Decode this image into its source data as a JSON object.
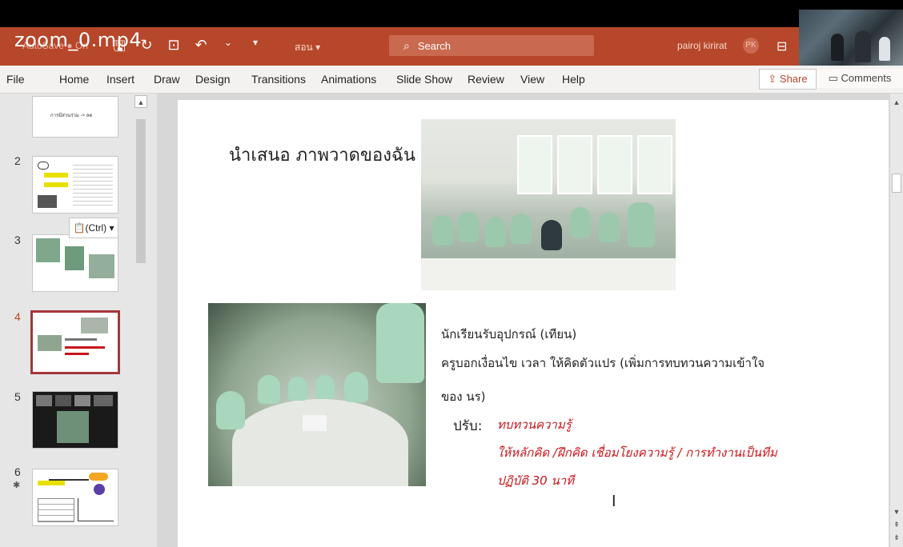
{
  "video_label": "zoom_0.mp4",
  "app": {
    "autosave_label": "AutoSave",
    "autosave_state": "On",
    "doc_name": "สอน ▾",
    "search_placeholder": "Search",
    "user_name": "pairoj kirirat",
    "user_initials": "PK"
  },
  "menu": {
    "items": [
      "File",
      "Home",
      "Insert",
      "Draw",
      "Design",
      "Transitions",
      "Animations",
      "Slide Show",
      "Review",
      "View",
      "Help"
    ],
    "share": "Share",
    "comments": "Comments"
  },
  "thumbnails": {
    "numbers": [
      "2",
      "3",
      "4",
      "5",
      "6"
    ],
    "selected": "4",
    "paste_chip": "(Ctrl) ▾",
    "slide1_caption": "การมีส่วนร่วม -> ลด"
  },
  "slide": {
    "title": "นำเสนอ ภาพวาดของฉัน",
    "line1": "นักเรียนรับอุปกรณ์ (เทียน)",
    "line2": "ครูบอกเงื่อนไข เวลา  ให้คิดตัวแปร (เพิ่มการทบทวนความเข้าใจ",
    "line3": "ของ นร)",
    "adjust_label": "ปรับ:",
    "red1": "ทบทวนความรู้",
    "red2": "ให้หลักคิด /ฝึกคิด เชื่อมโยงความรู้ / การทำงานเป็นทีม",
    "red3": "ปฏิบัติ 30 นาที"
  },
  "colors": {
    "accent": "#b7472a",
    "selected_border": "#a4373a",
    "red_text": "#c8151b"
  }
}
